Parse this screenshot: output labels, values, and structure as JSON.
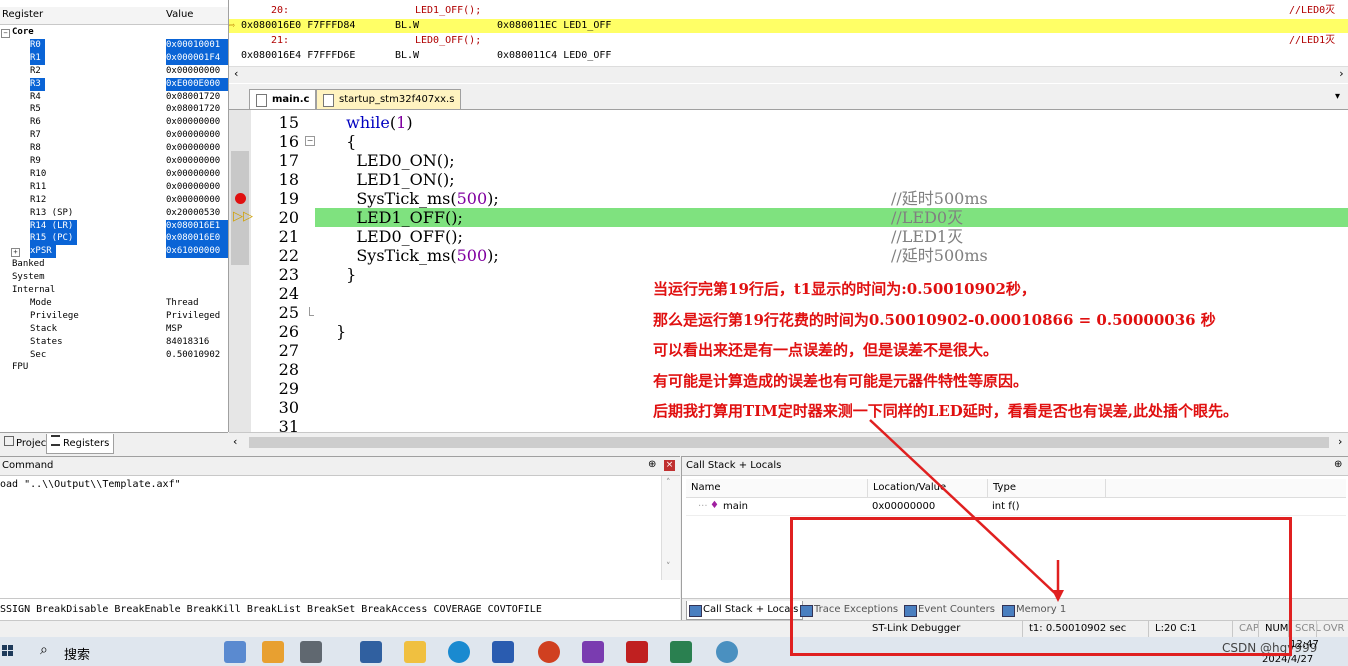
{
  "registers": {
    "header": {
      "name": "Register",
      "value": "Value"
    },
    "rows": [
      {
        "name": "Core",
        "value": "",
        "indent": 1,
        "sel": false,
        "bold": true,
        "expander": "−"
      },
      {
        "name": "R0",
        "value": "0x00010001",
        "indent": 3,
        "sel": true
      },
      {
        "name": "R1",
        "value": "0x000001F4",
        "indent": 3,
        "sel": true
      },
      {
        "name": "R2",
        "value": "0x00000000",
        "indent": 3,
        "sel": false
      },
      {
        "name": "R3",
        "value": "0xE000E000",
        "indent": 3,
        "sel": true
      },
      {
        "name": "R4",
        "value": "0x08001720",
        "indent": 3,
        "sel": false
      },
      {
        "name": "R5",
        "value": "0x08001720",
        "indent": 3,
        "sel": false
      },
      {
        "name": "R6",
        "value": "0x00000000",
        "indent": 3,
        "sel": false
      },
      {
        "name": "R7",
        "value": "0x00000000",
        "indent": 3,
        "sel": false
      },
      {
        "name": "R8",
        "value": "0x00000000",
        "indent": 3,
        "sel": false
      },
      {
        "name": "R9",
        "value": "0x00000000",
        "indent": 3,
        "sel": false
      },
      {
        "name": "R10",
        "value": "0x00000000",
        "indent": 3,
        "sel": false
      },
      {
        "name": "R11",
        "value": "0x00000000",
        "indent": 3,
        "sel": false
      },
      {
        "name": "R12",
        "value": "0x00000000",
        "indent": 3,
        "sel": false
      },
      {
        "name": "R13 (SP)",
        "value": "0x20000530",
        "indent": 3,
        "sel": false
      },
      {
        "name": "R14 (LR)",
        "value": "0x080016E1",
        "indent": 3,
        "sel": true
      },
      {
        "name": "R15 (PC)",
        "value": "0x080016E0",
        "indent": 3,
        "sel": true
      },
      {
        "name": "xPSR",
        "value": "0x61000000",
        "indent": 3,
        "sel": true,
        "expander": "+"
      },
      {
        "name": "Banked",
        "value": "",
        "indent": 1,
        "sel": false
      },
      {
        "name": "System",
        "value": "",
        "indent": 1,
        "sel": false
      },
      {
        "name": "Internal",
        "value": "",
        "indent": 1,
        "sel": false
      },
      {
        "name": "Mode",
        "value": "Thread",
        "indent": 3,
        "sel": false
      },
      {
        "name": "Privilege",
        "value": "Privileged",
        "indent": 3,
        "sel": false
      },
      {
        "name": "Stack",
        "value": "MSP",
        "indent": 3,
        "sel": false
      },
      {
        "name": "States",
        "value": "84018316",
        "indent": 3,
        "sel": false
      },
      {
        "name": "Sec",
        "value": "0.50010902",
        "indent": 3,
        "sel": false
      },
      {
        "name": "FPU",
        "value": "",
        "indent": 1,
        "sel": false
      }
    ],
    "tabs": {
      "project": "Project",
      "registers": "Registers"
    }
  },
  "disasm": {
    "lines": [
      {
        "a": "",
        "b": "20:",
        "c": "LED1_OFF();",
        "d": "",
        "cm": "//LED0灭",
        "hl": false,
        "src": true
      },
      {
        "a": "0x080016E0 F7FFFD84",
        "b": "BL.W",
        "c": "",
        "d": "0x080011EC LED1_OFF",
        "cm": "",
        "hl": true,
        "src": false
      },
      {
        "a": "",
        "b": "21:",
        "c": "LED0_OFF();",
        "d": "",
        "cm": "//LED1灭",
        "hl": false,
        "src": true
      },
      {
        "a": "0x080016E4 F7FFFD6E",
        "b": "BL.W",
        "c": "",
        "d": "0x080011C4 LED0_OFF",
        "cm": "",
        "hl": false,
        "src": false
      }
    ]
  },
  "file_tabs": [
    {
      "label": "main.c",
      "active": true
    },
    {
      "label": "startup_stm32f407xx.s",
      "active": false
    }
  ],
  "editor": {
    "lines": [
      {
        "n": "15",
        "code": "  while(1)",
        "cm": ""
      },
      {
        "n": "16",
        "code": "  {",
        "cm": ""
      },
      {
        "n": "17",
        "code": "    LED0_ON();",
        "cm": ""
      },
      {
        "n": "18",
        "code": "    LED1_ON();",
        "cm": ""
      },
      {
        "n": "19",
        "code": "    SysTick_ms(500);",
        "cm": "//延时500ms"
      },
      {
        "n": "20",
        "code": "    LED1_OFF();",
        "cm": "//LED0灭"
      },
      {
        "n": "21",
        "code": "    LED0_OFF();",
        "cm": "//LED1灭"
      },
      {
        "n": "22",
        "code": "    SysTick_ms(500);",
        "cm": "//延时500ms"
      },
      {
        "n": "23",
        "code": "  }",
        "cm": ""
      },
      {
        "n": "24",
        "code": "",
        "cm": ""
      },
      {
        "n": "25",
        "code": "",
        "cm": ""
      },
      {
        "n": "26",
        "code": "}",
        "cm": ""
      },
      {
        "n": "27",
        "code": "",
        "cm": ""
      },
      {
        "n": "28",
        "code": "",
        "cm": ""
      },
      {
        "n": "29",
        "code": "",
        "cm": ""
      },
      {
        "n": "30",
        "code": "",
        "cm": ""
      },
      {
        "n": "31",
        "code": "",
        "cm": ""
      }
    ],
    "breakpoint_line": "19",
    "current_line": "20"
  },
  "annotation": [
    "当运行完第19行后，t1显示的时间为:0.50010902秒，",
    "那么是运行第19行花费的时间为0.50010902-0.00010866 = 0.50000036 秒",
    "可以看出来还是有一点误差的，但是误差不是很大。",
    "有可能是计算造成的误差也有可能是元器件特性等原因。",
    "后期我打算用TIM定时器来测一下同样的LED延时，看看是否也有误差,此处插个眼先。"
  ],
  "command": {
    "title": "Command",
    "output": "oad \"..\\\\Output\\\\Template.axf\"",
    "input_hint": "SSIGN BreakDisable BreakEnable BreakKill BreakList BreakSet BreakAccess COVERAGE COVTOFILE"
  },
  "callstack": {
    "title": "Call Stack + Locals",
    "columns": [
      "Name",
      "Location/Value",
      "Type"
    ],
    "rows": [
      {
        "name": "main",
        "location": "0x00000000",
        "type": "int f()"
      }
    ],
    "tabs": [
      "Call Stack + Locals",
      "Trace Exceptions",
      "Event Counters",
      "Memory 1"
    ]
  },
  "status": {
    "debugger": "ST-Link Debugger",
    "t1": "t1: 0.50010902 sec",
    "pos": "L:20 C:1",
    "cap": "CAP",
    "num": "NUM",
    "scrl": "SCRL",
    "ovr": "OVR"
  },
  "taskbar": {
    "search": "搜索",
    "time": "12:47",
    "date": "2024/4/27",
    "watermark": "CSDN @hgy999"
  },
  "colors": {
    "selection": "#0a64d6",
    "current_line": "#7fe27f",
    "disasm_highlight": "#ffff66",
    "annotation": "#e01010"
  }
}
